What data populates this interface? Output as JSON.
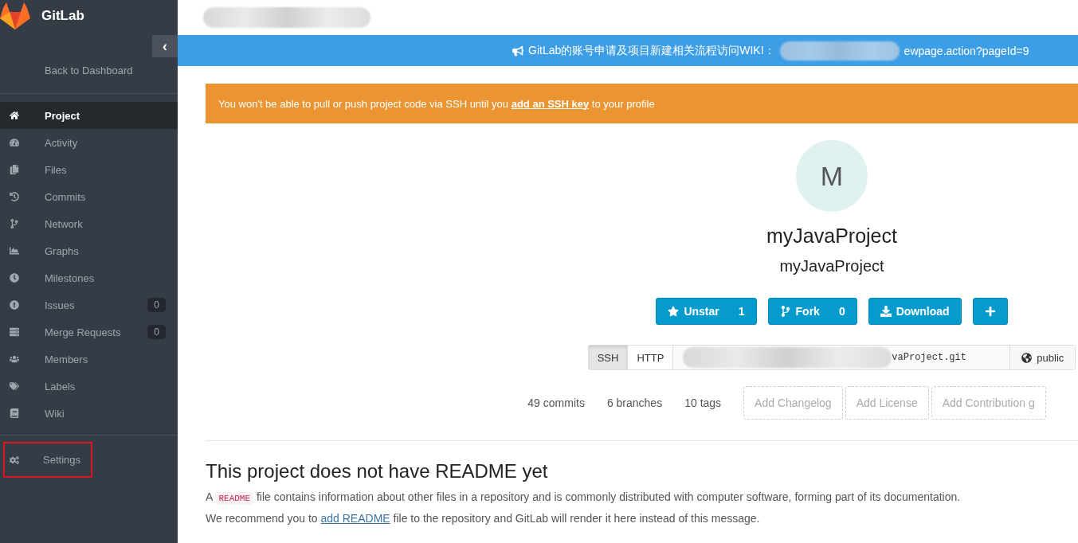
{
  "sidebar": {
    "brand": "GitLab",
    "collapse_icon": "‹",
    "back_link": "Back to Dashboard",
    "items": [
      {
        "label": "Project",
        "selected": true,
        "highlighted": false
      },
      {
        "label": "Activity",
        "selected": false,
        "highlighted": false
      },
      {
        "label": "Files",
        "selected": false,
        "highlighted": false
      },
      {
        "label": "Commits",
        "selected": false,
        "highlighted": false
      },
      {
        "label": "Network",
        "selected": false,
        "highlighted": false
      },
      {
        "label": "Graphs",
        "selected": false,
        "highlighted": false
      },
      {
        "label": "Milestones",
        "selected": false,
        "highlighted": false
      },
      {
        "label": "Issues",
        "count": "0",
        "selected": false,
        "highlighted": false
      },
      {
        "label": "Merge Requests",
        "count": "0",
        "selected": false,
        "highlighted": false
      },
      {
        "label": "Members",
        "selected": false,
        "highlighted": false
      },
      {
        "label": "Labels",
        "selected": false,
        "highlighted": false
      },
      {
        "label": "Wiki",
        "selected": false,
        "highlighted": false
      }
    ],
    "bottom_items": [
      {
        "label": "Settings",
        "selected": false,
        "highlighted": true
      }
    ]
  },
  "banner": {
    "text": "GitLab的账号申请及项目新建相关流程访问WIKI：",
    "link_tail": "ewpage.action?pageId=9"
  },
  "alert": {
    "before": "You won't be able to pull or push project code via SSH until you ",
    "link": "add an SSH key",
    "after": " to your profile"
  },
  "project": {
    "avatar_letter": "M",
    "title": "myJavaProject",
    "subtitle": "myJavaProject",
    "buttons": [
      {
        "kind": "star",
        "label": "Unstar",
        "count": "1"
      },
      {
        "kind": "fork",
        "label": "Fork",
        "count": "0"
      },
      {
        "kind": "download",
        "label": "Download"
      },
      {
        "kind": "plus"
      }
    ],
    "clone": {
      "protocols": [
        {
          "label": "SSH",
          "selected": true
        },
        {
          "label": "HTTP",
          "selected": false
        }
      ],
      "url_tail": "vaProject.git",
      "visibility": "public"
    },
    "stats": [
      "49 commits",
      "6 branches",
      "10 tags"
    ],
    "add_links": [
      "Add Changelog",
      "Add License",
      "Add Contribution g"
    ]
  },
  "readme": {
    "heading": "This project does not have README yet",
    "line1_before": "A ",
    "line1_code": "README",
    "line1_after": " file contains information about other files in a repository and is commonly distributed with computer software, forming part of its documentation.",
    "line2_before": "We recommend you to ",
    "line2_link": "add README",
    "line2_after": " file to the repository and GitLab will render it here instead of this message."
  }
}
